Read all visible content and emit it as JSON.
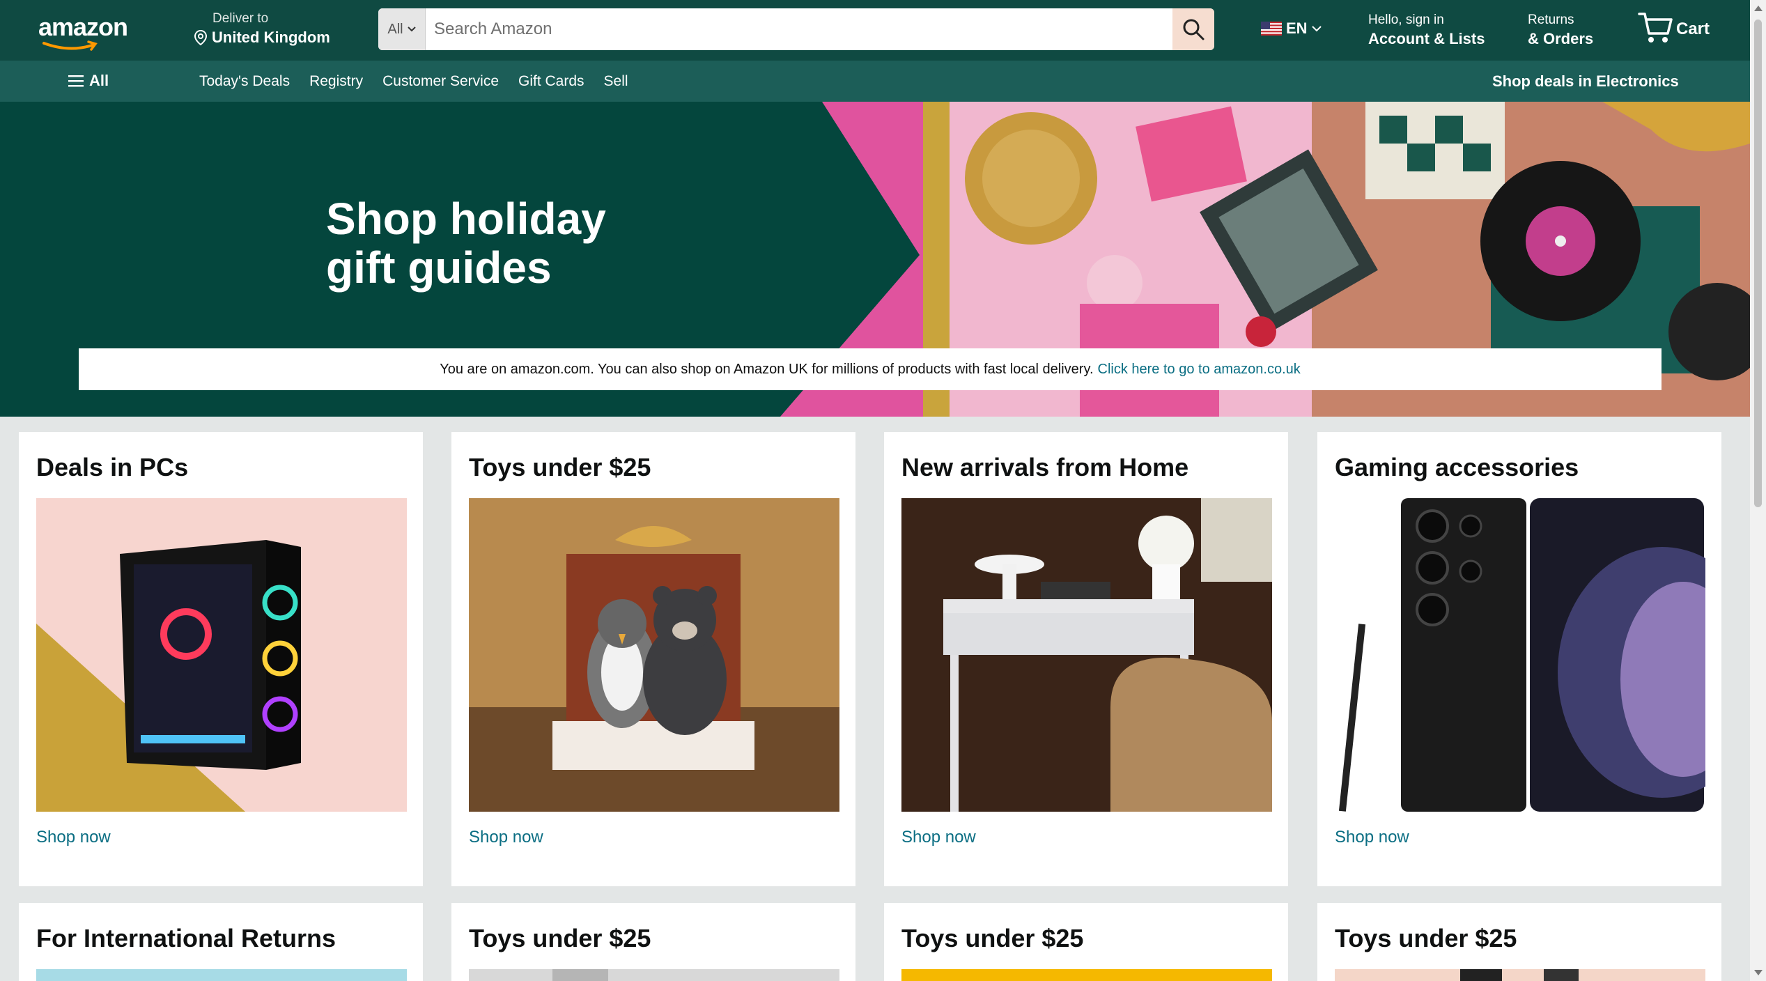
{
  "header": {
    "logo": "amazon",
    "deliver_small": "Deliver to",
    "deliver_big": "United Kingdom",
    "search_category": "All",
    "search_placeholder": "Search Amazon",
    "lang": "EN",
    "account_small": "Hello, sign in",
    "account_big": "Account & Lists",
    "returns_small": "Returns",
    "returns_big": "& Orders",
    "cart_label": "Cart"
  },
  "subnav": {
    "all_label": "All",
    "links": [
      "Today's Deals",
      "Registry",
      "Customer Service",
      "Gift Cards",
      "Sell"
    ],
    "promo": "Shop deals in Electronics"
  },
  "hero": {
    "title_line1": "Shop holiday",
    "title_line2": "gift guides"
  },
  "notice": {
    "text": "You are on amazon.com. You can also shop on Amazon UK for millions of products with fast local delivery.",
    "link": "Click here to go to amazon.co.uk"
  },
  "cards": [
    {
      "title": "Deals in PCs",
      "cta": "Shop now"
    },
    {
      "title": "Toys under $25",
      "cta": "Shop now"
    },
    {
      "title": "New arrivals from Home",
      "cta": "Shop now"
    },
    {
      "title": "Gaming accessories",
      "cta": "Shop now"
    },
    {
      "title": "For International Returns"
    },
    {
      "title": "Toys under $25"
    },
    {
      "title": "Toys under $25"
    },
    {
      "title": "Toys under $25"
    }
  ],
  "colors": {
    "nav_bg": "#0f4a42",
    "subnav_bg": "#1c5e58",
    "hero_bg": "#04463d",
    "link": "#0b6e83",
    "page_bg": "#e3e6e6"
  }
}
